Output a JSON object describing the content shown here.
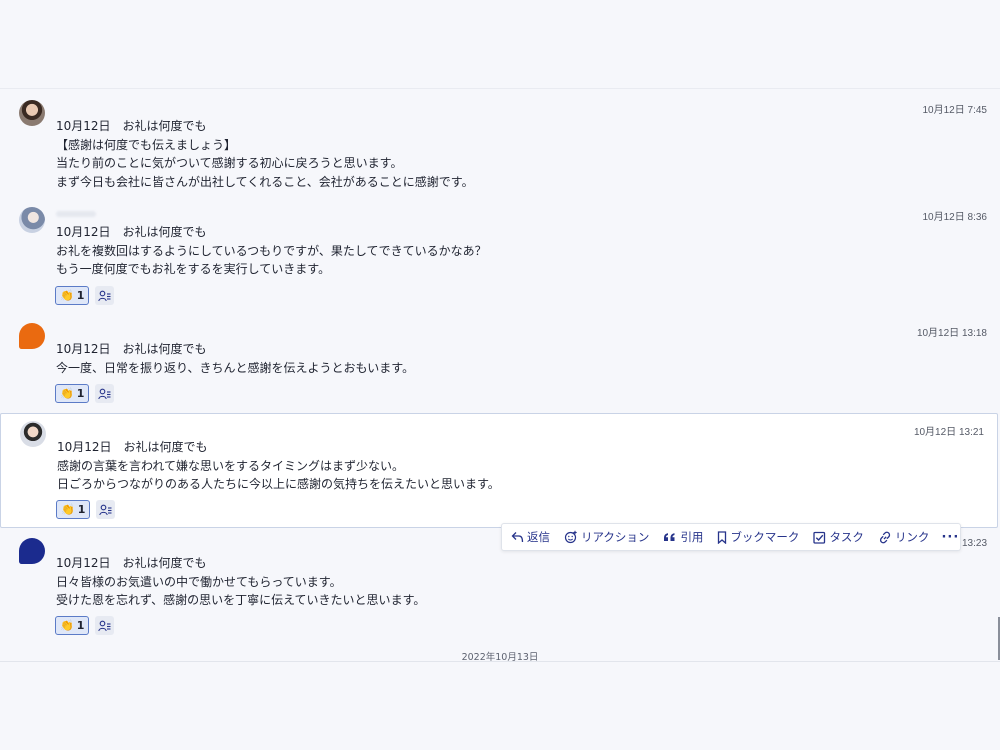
{
  "messages": [
    {
      "timestamp": "10月12日 7:45",
      "lines": [
        "10月12日　お礼は何度でも",
        "【感謝は何度でも伝えましょう】",
        "当たり前のことに気がついて感謝する初心に戻ろうと思います。",
        "まず今日も会社に皆さんが出社してくれること、会社があることに感謝です。"
      ]
    },
    {
      "timestamp": "10月12日 8:36",
      "lines": [
        "10月12日　お礼は何度でも",
        "お礼を複数回はするようにしているつもりですが、果たしてできているかなあ？",
        "もう一度何度でもお礼をするを実行していきます。"
      ],
      "reaction_count": "1"
    },
    {
      "timestamp": "10月12日 13:18",
      "lines": [
        "10月12日　お礼は何度でも",
        "今一度、日常を振り返り、きちんと感謝を伝えようとおもいます。"
      ],
      "reaction_count": "1"
    },
    {
      "timestamp": "10月12日 13:21",
      "lines": [
        "10月12日　お礼は何度でも",
        "感謝の言葉を言われて嫌な思いをするタイミングはまず少ない。",
        "日ごろからつながりのある人たちに今以上に感謝の気持ちを伝えたいと思います。"
      ],
      "reaction_count": "1"
    },
    {
      "timestamp_partial": "13:23",
      "lines": [
        "10月12日　お礼は何度でも",
        "日々皆様のお気遣いの中で働かせてもらっています。",
        "受けた恩を忘れず、感謝の思いを丁寧に伝えていきたいと思います。"
      ],
      "reaction_count": "1"
    }
  ],
  "toolbar": {
    "reply": "返信",
    "reaction": "リアクション",
    "quote": "引用",
    "bookmark": "ブックマーク",
    "task": "タスク",
    "link": "リンク",
    "more": "···"
  },
  "date_divider": "2022年10月13日",
  "colors": {
    "accent": "#27348b",
    "chip_border": "#5b7bc7",
    "avatar_orange": "#ea6a10",
    "avatar_navy": "#1b2b8e"
  },
  "icons": {
    "reaction_emoji": "clapping-hands-icon",
    "add_reaction": "add-user-reaction-icon"
  }
}
